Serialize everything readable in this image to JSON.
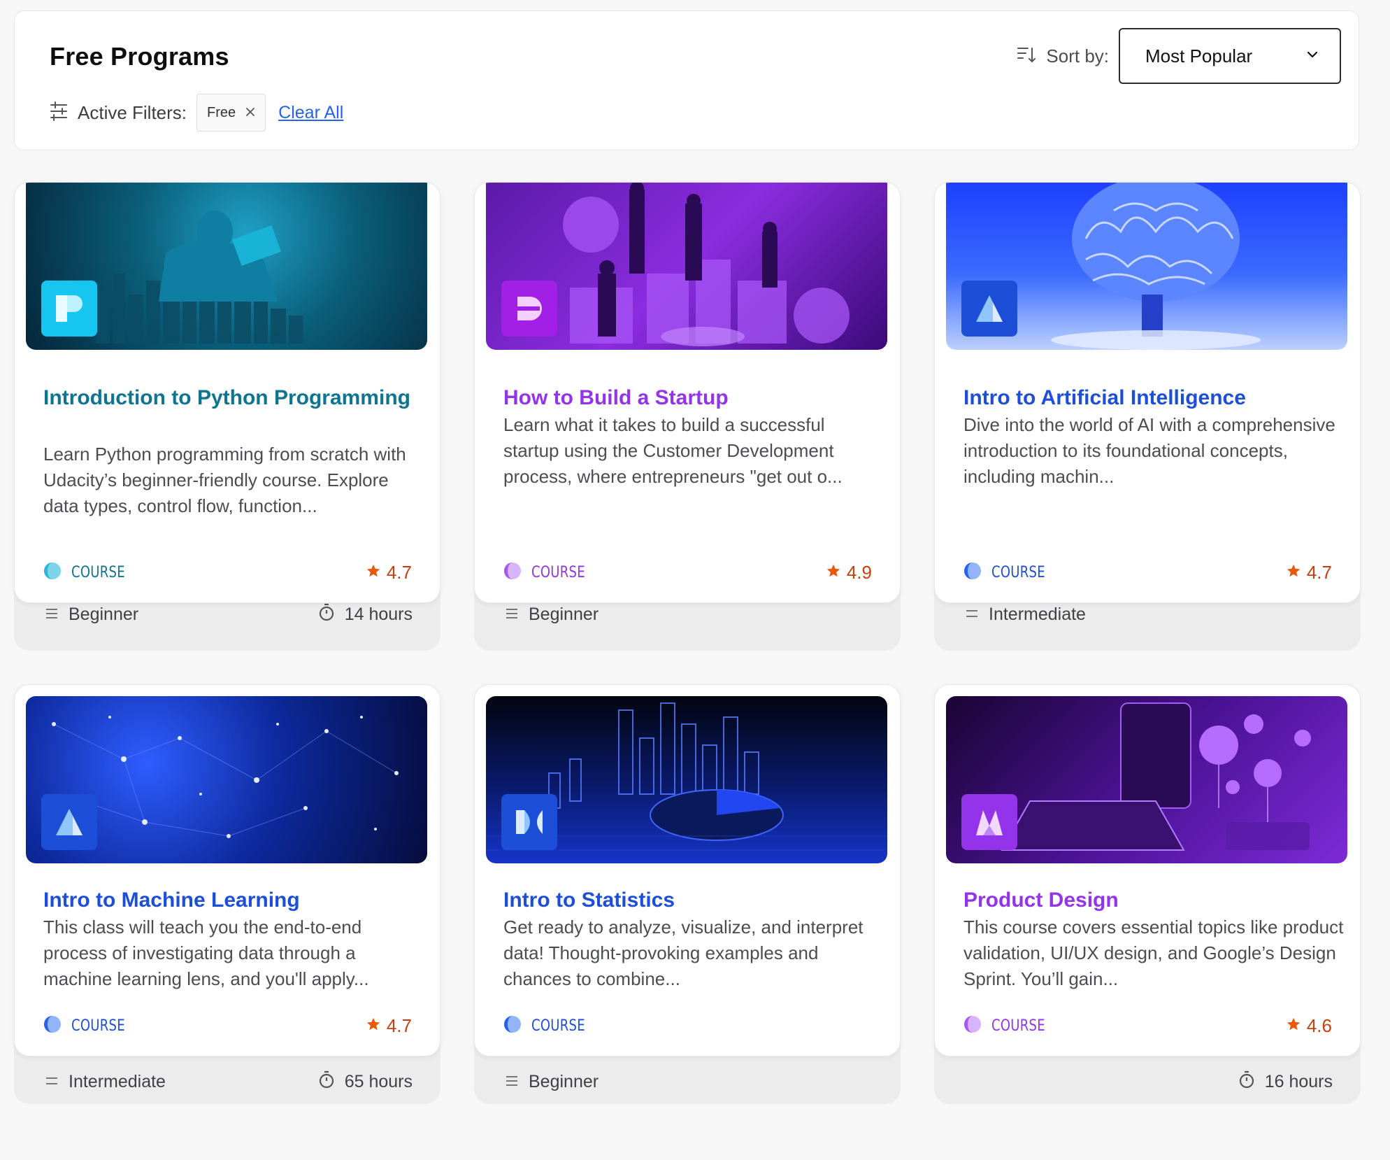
{
  "header": {
    "title": "Free Programs",
    "sort_label": "Sort by:",
    "sort_value": "Most Popular",
    "filters_label": "Active Filters:",
    "active_filter": "Free",
    "clear_all": "Clear All"
  },
  "cards": [
    {
      "title": "Introduction to Python Programming",
      "description": "Learn Python programming from scratch with Udacity’s beginner-friendly course. Explore data types, control flow, function...",
      "type": "COURSE",
      "rating": "4.7",
      "level": "Beginner",
      "duration": "14 hours",
      "accent": "#0e7490",
      "logo": "python-program-logo"
    },
    {
      "title": "How to Build a Startup",
      "description": "Learn what it takes to build a successful startup using the Customer Development process, where entrepreneurs \"get out o...",
      "type": "COURSE",
      "rating": "4.9",
      "level": "Beginner",
      "duration": "",
      "accent": "#9333ea",
      "logo": "business-program-logo"
    },
    {
      "title": "Intro to Artificial Intelligence",
      "description": "Dive into the world of AI with a comprehensive introduction to its foundational concepts, including machin...",
      "type": "COURSE",
      "rating": "4.7",
      "level": "Intermediate",
      "duration": "",
      "accent": "#1d4ed8",
      "logo": "ai-program-logo"
    },
    {
      "title": "Intro to Machine Learning",
      "description": "This class will teach you the end-to-end process of investigating data through a machine learning lens, and you'll apply...",
      "type": "COURSE",
      "rating": "4.7",
      "level": "Intermediate",
      "duration": "65 hours",
      "accent": "#1d4ed8",
      "logo": "ai-program-logo"
    },
    {
      "title": "Intro to Statistics",
      "description": "Get ready to analyze, visualize, and interpret data! Thought-provoking examples and chances to combine...",
      "type": "COURSE",
      "rating": "",
      "level": "Beginner",
      "duration": "",
      "accent": "#1d4ed8",
      "logo": "data-science-program-logo"
    },
    {
      "title": "Product Design",
      "description": "This course covers essential topics like product validation, UI/UX design, and Google’s Design Sprint. You’ll gain...",
      "type": "COURSE",
      "rating": "4.6",
      "level": "",
      "duration": "16 hours",
      "accent": "#9333ea",
      "logo": "product-program-logo"
    }
  ]
}
